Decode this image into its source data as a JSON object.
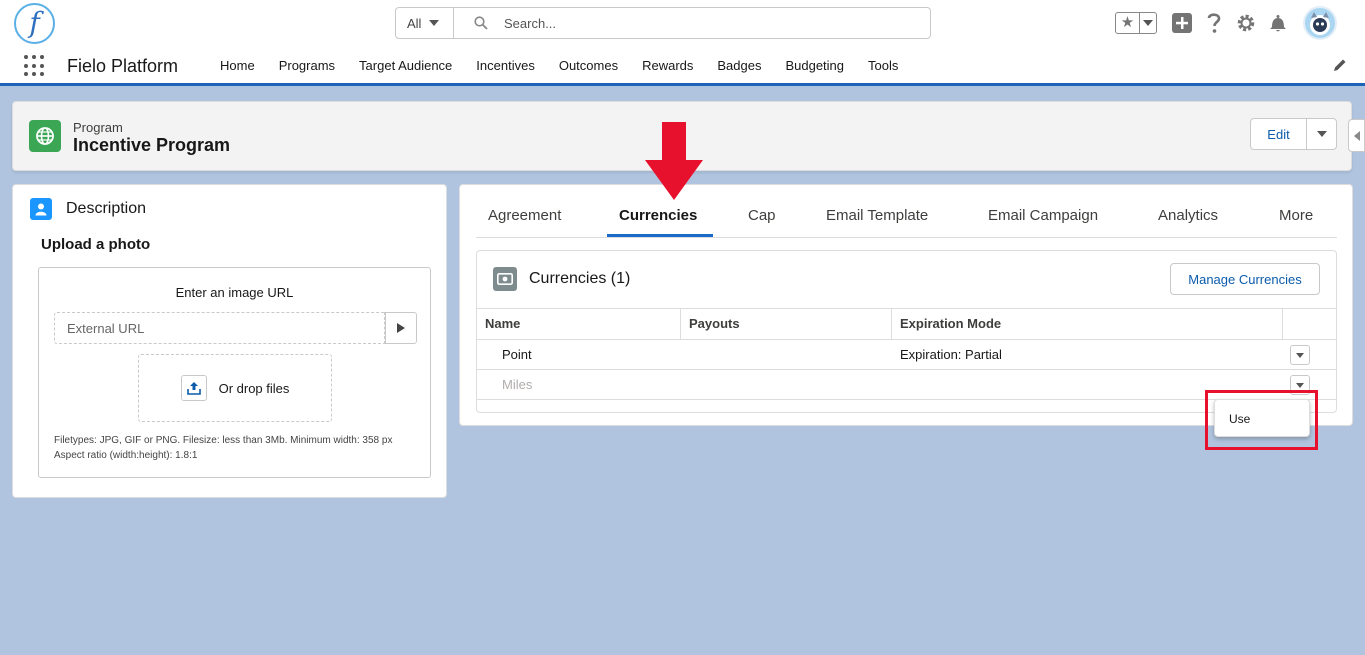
{
  "header": {
    "logo_letter": "f",
    "search_scope": "All",
    "search_placeholder": "Search..."
  },
  "nav": {
    "app_name": "Fielo Platform",
    "items": [
      "Home",
      "Programs",
      "Target Audience",
      "Incentives",
      "Outcomes",
      "Rewards",
      "Badges",
      "Budgeting",
      "Tools"
    ]
  },
  "record": {
    "type_label": "Program",
    "title": "Incentive Program",
    "edit_label": "Edit"
  },
  "description_card": {
    "title": "Description",
    "upload_title": "Upload a photo",
    "url_label": "Enter an image URL",
    "url_placeholder": "External URL",
    "drop_label": "Or drop files",
    "help_line1": "Filetypes: JPG, GIF or PNG. Filesize: less than 3Mb. Minimum width: 358 px",
    "help_line2": "Aspect ratio (width:height): 1.8:1"
  },
  "tabs": [
    "Agreement",
    "Currencies",
    "Cap",
    "Email Template",
    "Email Campaign",
    "Analytics",
    "More"
  ],
  "active_tab": "Currencies",
  "currencies": {
    "title": "Currencies (1)",
    "manage_label": "Manage Currencies",
    "columns": [
      "Name",
      "Payouts",
      "Expiration Mode"
    ],
    "rows": [
      {
        "name": "Point",
        "payouts": "",
        "expiration": "Expiration: Partial"
      },
      {
        "name": "Miles",
        "payouts": "",
        "expiration": ""
      }
    ]
  },
  "row_menu": {
    "item": "Use"
  },
  "colors": {
    "brand_blue": "#1f63b8",
    "page_bg": "#b0c4df",
    "record_icon": "#3ba755",
    "highlight_red": "#e8112d"
  }
}
